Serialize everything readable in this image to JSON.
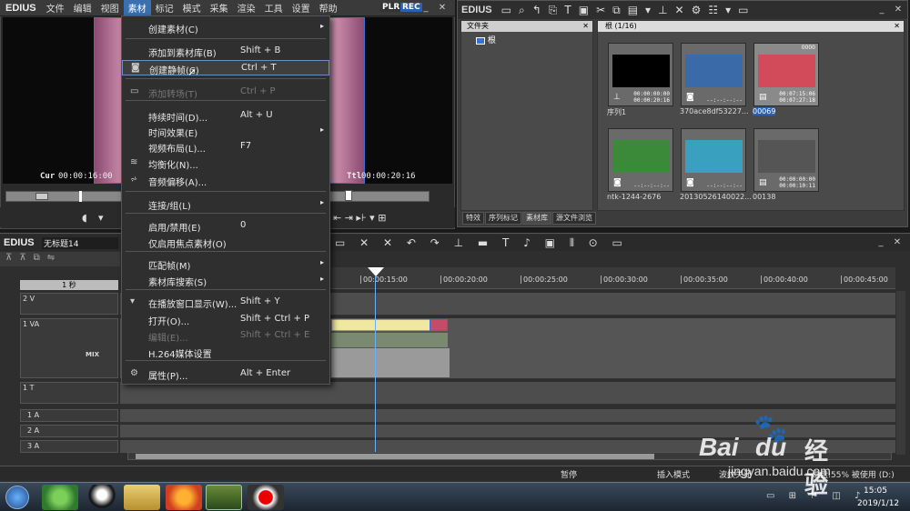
{
  "app": {
    "name": "EDIUS",
    "plr": "PLR",
    "rec": "REC"
  },
  "menubar": [
    "文件",
    "编辑",
    "视图",
    "素材",
    "标记",
    "模式",
    "采集",
    "渲染",
    "工具",
    "设置",
    "帮助"
  ],
  "active_menu": "素材",
  "preview": {
    "cur_label": "Cur",
    "cur": "00:00:16:00",
    "ttl_label": "Ttl",
    "ttl": "00:00:20:16"
  },
  "context_menu": [
    {
      "label": "创建素材(C)",
      "shortcut": "",
      "submenu": true,
      "disabled": false
    },
    {
      "label": "添加到素材库(B)",
      "shortcut": "Shift + B",
      "submenu": false,
      "disabled": false
    },
    {
      "label": "创建静帧(C)",
      "shortcut": "Ctrl + T",
      "submenu": false,
      "disabled": false,
      "highlight": true
    },
    {
      "label": "添加转场(T)",
      "shortcut": "Ctrl + P",
      "submenu": false,
      "disabled": true
    },
    {
      "label": "持续时间(D)...",
      "shortcut": "Alt + U",
      "submenu": false,
      "disabled": false
    },
    {
      "label": "时间效果(E)",
      "shortcut": "",
      "submenu": true,
      "disabled": false
    },
    {
      "label": "视频布局(L)...",
      "shortcut": "F7",
      "submenu": false,
      "disabled": false
    },
    {
      "label": "均衡化(N)...",
      "shortcut": "",
      "submenu": false,
      "disabled": false
    },
    {
      "label": "音频偏移(A)...",
      "shortcut": "",
      "submenu": false,
      "disabled": false
    },
    {
      "label": "连接/组(L)",
      "shortcut": "",
      "submenu": true,
      "disabled": false
    },
    {
      "label": "启用/禁用(E)",
      "shortcut": "0",
      "submenu": false,
      "disabled": false
    },
    {
      "label": "仅启用焦点素材(O)",
      "shortcut": "",
      "submenu": false,
      "disabled": false
    },
    {
      "label": "匹配帧(M)",
      "shortcut": "",
      "submenu": true,
      "disabled": false
    },
    {
      "label": "素材库搜索(S)",
      "shortcut": "",
      "submenu": true,
      "disabled": false
    },
    {
      "label": "在播放窗口显示(W)...",
      "shortcut": "Shift + Y",
      "submenu": false,
      "disabled": false
    },
    {
      "label": "打开(O)...",
      "shortcut": "Shift + Ctrl + P",
      "submenu": false,
      "disabled": false
    },
    {
      "label": "编辑(E)...",
      "shortcut": "Shift + Ctrl + E",
      "submenu": false,
      "disabled": true
    },
    {
      "label": "H.264媒体设置",
      "shortcut": "",
      "submenu": false,
      "disabled": false
    },
    {
      "label": "属性(P)...",
      "shortcut": "Alt + Enter",
      "submenu": false,
      "disabled": false
    }
  ],
  "bin": {
    "title": "EDIUS",
    "folder_header": "文件夹",
    "root_folder": "根",
    "clip_header": "根 (1/16)",
    "clips": [
      {
        "name": "序列1",
        "tc1": "00:00:00:00",
        "tc2": "00:00:20:16",
        "color": "#000000"
      },
      {
        "name": "370ace8df53227...",
        "tc1": "--:--:--:--",
        "tc2": "",
        "color": "#3a6aa8"
      },
      {
        "name": "00069",
        "tc1": "00:07:15:06",
        "tc2": "00:07:27:18",
        "color": "#d14b5a",
        "top": "0000"
      },
      {
        "name": "ntk-1244-2676",
        "tc1": "--:--:--:--",
        "tc2": "",
        "color": "#3b8a3a"
      },
      {
        "name": "20130526140022...",
        "tc1": "--:--:--:--",
        "tc2": "",
        "color": "#3aa0c0"
      },
      {
        "name": "00138",
        "tc1": "00:00:00:00",
        "tc2": "00:00:10:11",
        "color": "#555555"
      }
    ],
    "tabs": [
      "特效",
      "序列标记",
      "素材库",
      "源文件浏览"
    ]
  },
  "timeline": {
    "logo": "EDIUS",
    "name": "无标题14",
    "zoom": "1 秒",
    "ruler": [
      "00:00:15:00",
      "00:00:20:00",
      "00:00:25:00",
      "00:00:30:00",
      "00:00:35:00",
      "00:00:40:00",
      "00:00:45:00"
    ],
    "tracks": [
      {
        "id": "2 V"
      },
      {
        "id": "1 VA",
        "mix": "MIX"
      },
      {
        "id": "1 T"
      },
      {
        "id": "1 A"
      },
      {
        "id": "2 A"
      },
      {
        "id": "3 A"
      }
    ]
  },
  "status": {
    "pause": "暂停",
    "insert": "插入模式",
    "wave": "波纹关闭",
    "disk": "磁盘:55% 被使用 (D:)"
  },
  "taskbar": {
    "time": "15:05",
    "date": "2019/1/12"
  },
  "watermark": {
    "brand": "Bai",
    "brand2": "du",
    "cn": "经验",
    "url": "jingyan.baidu.com"
  }
}
